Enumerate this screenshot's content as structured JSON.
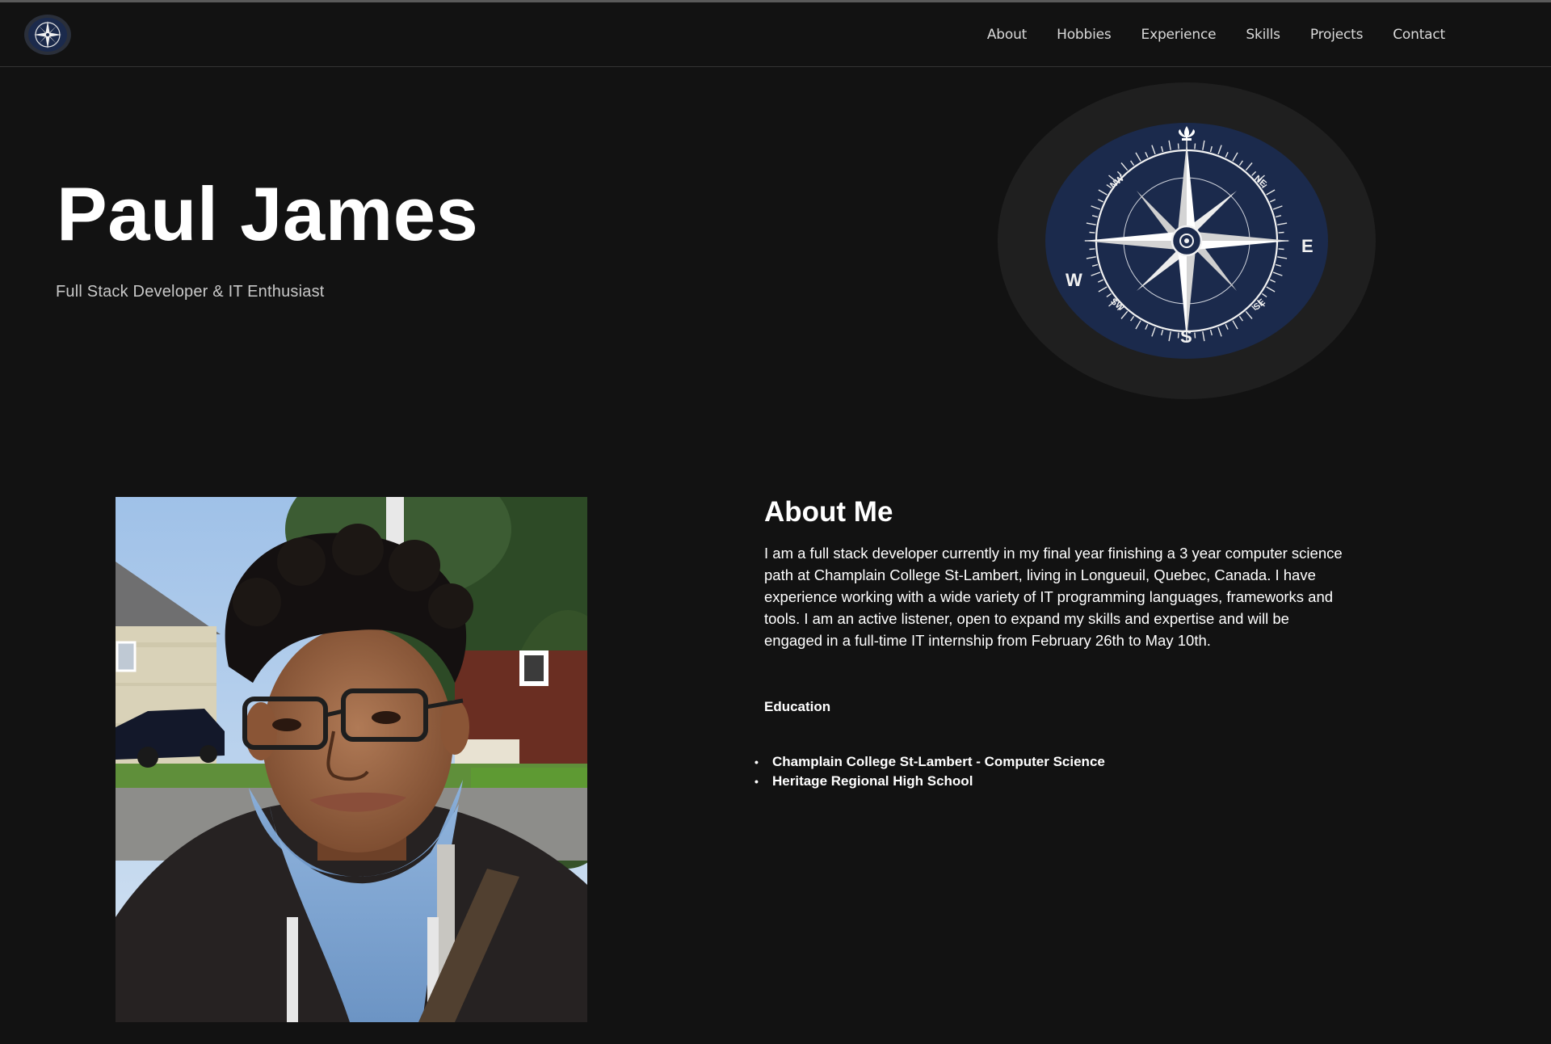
{
  "nav": {
    "logo_icon": "compass-rose-icon",
    "links": [
      {
        "label": "About"
      },
      {
        "label": "Hobbies"
      },
      {
        "label": "Experience"
      },
      {
        "label": "Skills"
      },
      {
        "label": "Projects"
      },
      {
        "label": "Contact"
      }
    ]
  },
  "hero": {
    "name": "Paul James",
    "subtitle": "Full Stack Developer & IT Enthusiast",
    "badge": {
      "icon": "compass-rose-icon",
      "directions": {
        "north_icon": "fleur-de-lis-icon",
        "east": "E",
        "south": "S",
        "west": "W",
        "ne": "NE",
        "nw": "NW",
        "se": "SE",
        "sw": "SW"
      },
      "colors": {
        "disc": "#1b2a4c",
        "halo": "#1f1f1f",
        "ink": "#f2f2f2"
      }
    }
  },
  "about": {
    "photo_icon": "profile-photo",
    "title": "About Me",
    "body": "I am a full stack developer currently in my final year finishing a 3 year computer science path at Champlain College St-Lambert, living in Longueuil, Quebec, Canada. I have experience working with a wide variety of IT programming languages, frameworks and tools. I am an active listener, open to expand my skills and expertise and will be engaged in a full-time IT internship from February 26th to May 10th.",
    "education_heading": "Education",
    "education": [
      "Champlain College St-Lambert - Computer Science",
      "Heritage Regional High School"
    ]
  },
  "colors": {
    "background": "#121212",
    "text": "#ffffff",
    "subtitle": "#c8c8c8",
    "nav_text": "#d9d9d9"
  }
}
